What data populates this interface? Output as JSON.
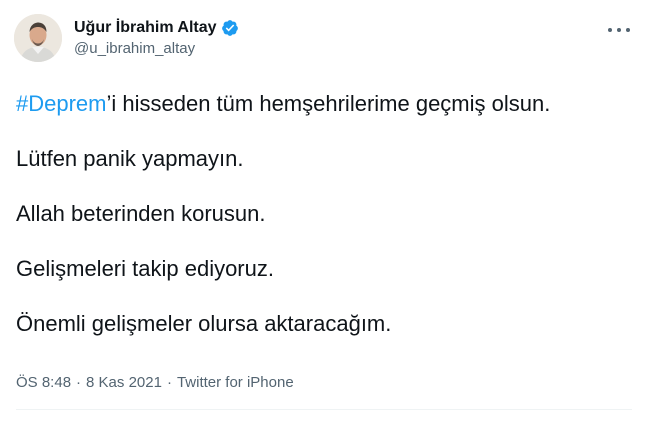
{
  "user": {
    "display_name": "Uğur İbrahim Altay",
    "handle": "@u_ibrahim_altay",
    "verified": true
  },
  "tweet": {
    "line1": {
      "hashtag": "#Deprem",
      "rest": "’i hisseden tüm hemşehrilerime geçmiş olsun."
    },
    "line2": "Lütfen panik yapmayın.",
    "line3": "Allah beterinden korusun.",
    "line4": "Gelişmeleri takip ediyoruz.",
    "line5": "Önemli gelişmeler olursa aktaracağım."
  },
  "meta": {
    "time": "ÖS 8:48",
    "date": "8 Kas 2021",
    "separator": "·",
    "source": "Twitter for iPhone"
  },
  "colors": {
    "link": "#1d9bf0",
    "secondary_text": "#536471",
    "primary_text": "#0f1419",
    "divider": "#eff3f4"
  },
  "icons": {
    "verified": "verified-badge-icon",
    "more": "more-options-icon"
  }
}
